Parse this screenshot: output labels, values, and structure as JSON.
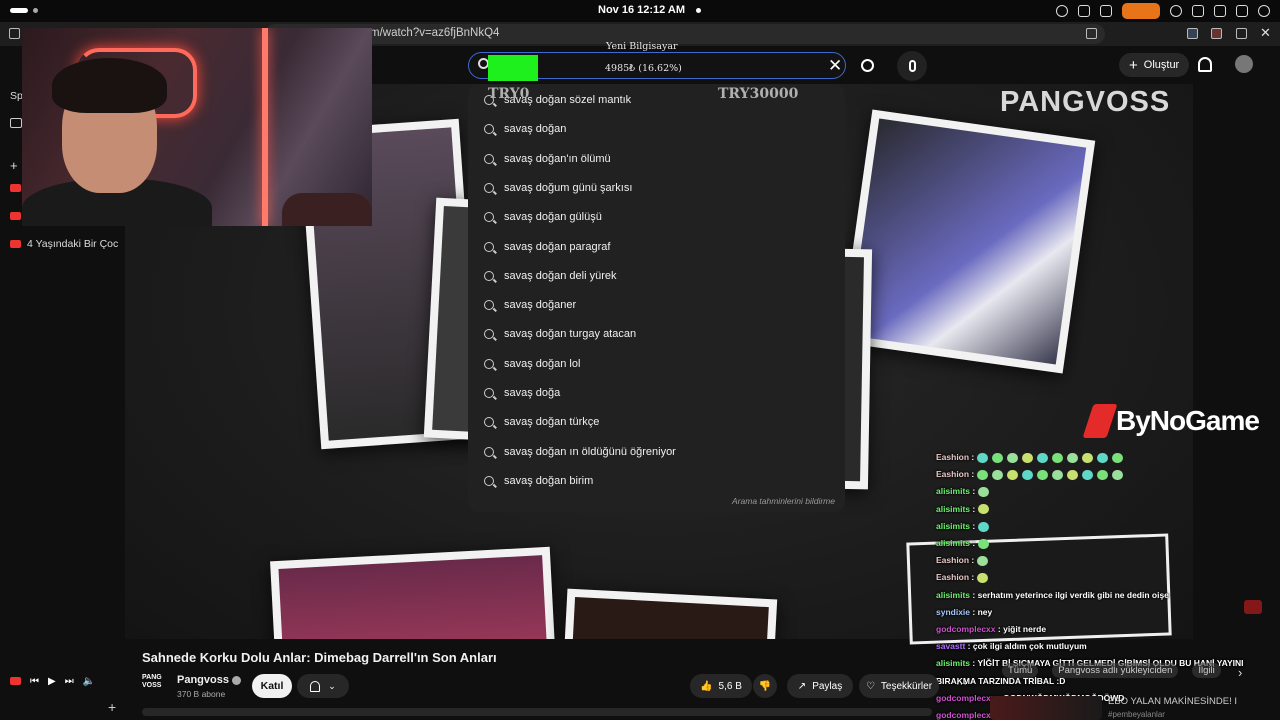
{
  "system": {
    "clock": "Nov 16  12:12 AM"
  },
  "browser": {
    "url_visible": "m/watch?v=az6fjBnNkQ4"
  },
  "sidebar": {
    "partial_label": "Sp",
    "recent_item": "4 Yaşındaki Bir Çoc"
  },
  "donation": {
    "title": "Yeni Bilgisayar",
    "amount": "4985₺ (16.62%)",
    "progress_fraction": 0.1662,
    "min": "TRY0",
    "max": "TRY30000"
  },
  "header": {
    "create_label": "Oluştur"
  },
  "suggestions": {
    "items": [
      "savaş doğan sözel mantık",
      "savaş doğan",
      "savaş doğan'ın ölümü",
      "savaş doğum günü şarkısı",
      "savaş doğan gülüşü",
      "savaş doğan paragraf",
      "savaş doğan deli yürek",
      "savaş doğaner",
      "savaş doğan turgay atacan",
      "savaş doğan lol",
      "savaş doğa",
      "savaş doğan türkçe",
      "savaş doğan ın öldüğünü öğreniyor",
      "savaş doğan birim"
    ],
    "report": "Arama tahminlerini bildirme"
  },
  "video": {
    "watermark": "PANGVOSS",
    "sponsor": "ByNoGame",
    "title": "Sahnede Korku Dolu Anlar: Dimebag Darrell'ın Son Anları",
    "channel_logo_line1": "PANG",
    "channel_logo_line2": "VOSS",
    "channel_name": "Pangvoss",
    "subscribers": "370 B abone",
    "join_label": "Katıl",
    "likes": "5,6 B",
    "share_label": "Paylaş",
    "thanks_label": "Teşekkürler",
    "more_label": "···"
  },
  "chat": {
    "messages": [
      {
        "user": "Eashion",
        "text": "",
        "color": "#e8c8c8",
        "emotes": 10
      },
      {
        "user": "Eashion",
        "text": "",
        "color": "#e8c8c8",
        "emotes": 10
      },
      {
        "user": "alisimits",
        "text": "",
        "color": "#6cf56c",
        "emotes": 1
      },
      {
        "user": "alisimits",
        "text": "",
        "color": "#6cf56c",
        "emotes": 1
      },
      {
        "user": "alisimits",
        "text": "",
        "color": "#6cf56c",
        "emotes": 1
      },
      {
        "user": "alisimits",
        "text": "",
        "color": "#6cf56c",
        "emotes": 1
      },
      {
        "user": "Eashion",
        "text": "",
        "color": "#e8c8c8",
        "emotes": 1
      },
      {
        "user": "Eashion",
        "text": "",
        "color": "#e8c8c8",
        "emotes": 1
      },
      {
        "user": "alisimits",
        "text": "serhatım yeterince ilgi verdik gibi ne dedin oişe",
        "color": "#6cf56c",
        "emotes": 0
      },
      {
        "user": "syndixie",
        "text": "ney",
        "color": "#a8c8ff",
        "emotes": 0
      },
      {
        "user": "godcomplecxx",
        "text": "yiğit nerde",
        "color": "#d050d0",
        "emotes": 0
      },
      {
        "user": "savastt",
        "text": "çok ilgi aldım çok mutluyum",
        "color": "#b070ff",
        "emotes": 0
      },
      {
        "user": "alisimits",
        "text": "YİĞİT Bİ SIÇMAYA GİTTİ GELMEDİ GİBİMSİ OLDU BU HANİ YAYINI",
        "color": "#6cf56c",
        "emotes": 0
      },
      {
        "user": "",
        "text": "BIRAKMA TARZINDA TRİBAL :D",
        "color": "#ffffff",
        "emotes": 0
      },
      {
        "user": "godcomplecxx",
        "text": "OQDNWĞDMWĞDMQĞDÖWD",
        "color": "#d050d0",
        "emotes": 0
      },
      {
        "user": "godcomplecxx",
        "text": "SAVAS COK MUTLU",
        "color": "#d050d0",
        "emotes": 0
      }
    ]
  },
  "below_player": {
    "tags": [
      "Tümü",
      "Pangvoss adlı yükleyiciden",
      "İlgili"
    ],
    "reco_title": "EBO YALAN MAKİNESİNDE! I",
    "reco_meta": "#pembeyalanlar"
  }
}
